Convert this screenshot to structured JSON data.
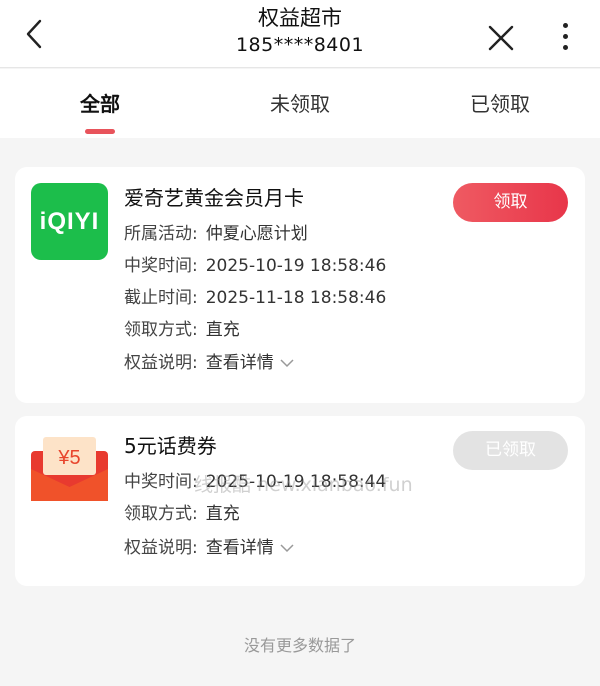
{
  "header": {
    "title": "权益超市",
    "subtitle": "185****8401"
  },
  "tabs": [
    {
      "label": "全部",
      "active": true
    },
    {
      "label": "未领取",
      "active": false
    },
    {
      "label": "已领取",
      "active": false
    }
  ],
  "items": [
    {
      "logo_text": "iQIYI",
      "name": "爱奇艺黄金会员月卡",
      "fields": [
        {
          "label": "所属活动:",
          "value": "仲夏心愿计划"
        },
        {
          "label": "中奖时间:",
          "value": "2025-10-19 18:58:46"
        },
        {
          "label": "截止时间:",
          "value": "2025-11-18 18:58:46"
        },
        {
          "label": "领取方式:",
          "value": "直充"
        }
      ],
      "detail_label": "权益说明:",
      "detail_link": "查看详情",
      "button": "领取"
    },
    {
      "logo_text": "¥5",
      "name": "5元话费券",
      "fields": [
        {
          "label": "中奖时间:",
          "value": "2025-10-19 18:58:44"
        },
        {
          "label": "领取方式:",
          "value": "直充"
        }
      ],
      "detail_label": "权益说明:",
      "detail_link": "查看详情",
      "button": "已领取"
    }
  ],
  "watermark": "线报酷 new.xianbao.fun",
  "footer": "没有更多数据了",
  "colors": {
    "accent": "#e8535b",
    "iqiyi_green": "#1cbe4b"
  }
}
